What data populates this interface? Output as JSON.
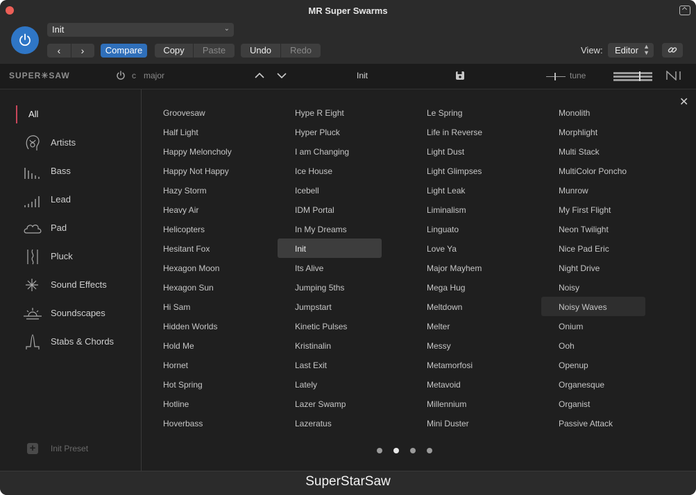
{
  "window": {
    "title": "MR Super Swarms"
  },
  "toolbar": {
    "preset_value": "Init",
    "prev_label": "‹",
    "next_label": "›",
    "compare_label": "Compare",
    "copy_label": "Copy",
    "paste_label": "Paste",
    "undo_label": "Undo",
    "redo_label": "Redo",
    "view_label": "View:",
    "view_value": "Editor"
  },
  "plugin_header": {
    "logo": "SUPER✳SAW",
    "key": "c",
    "scale": "major",
    "preset_name": "Init",
    "tune_label": "tune"
  },
  "sidebar": {
    "categories": [
      {
        "label": "All",
        "icon": "all-indicator"
      },
      {
        "label": "Artists",
        "icon": "artist-head-icon"
      },
      {
        "label": "Bass",
        "icon": "bass-bars-icon"
      },
      {
        "label": "Lead",
        "icon": "lead-bars-icon"
      },
      {
        "label": "Pad",
        "icon": "cloud-icon"
      },
      {
        "label": "Pluck",
        "icon": "pluck-icon"
      },
      {
        "label": "Sound Effects",
        "icon": "sparkle-icon"
      },
      {
        "label": "Soundscapes",
        "icon": "sunrise-icon"
      },
      {
        "label": "Stabs & Chords",
        "icon": "peak-icon"
      }
    ],
    "init_preset_label": "Init Preset"
  },
  "presets": {
    "columns": [
      [
        "Groovesaw",
        "Half Light",
        "Happy Meloncholy",
        "Happy Not Happy",
        "Hazy Storm",
        "Heavy Air",
        "Helicopters",
        "Hesitant Fox",
        "Hexagon Moon",
        "Hexagon Sun",
        "Hi Sam",
        "Hidden Worlds",
        "Hold Me",
        "Hornet",
        "Hot Spring",
        "Hotline",
        "Hoverbass"
      ],
      [
        "Hype R Eight",
        "Hyper Pluck",
        "I am Changing",
        "Ice House",
        "Icebell",
        "IDM Portal",
        "In My Dreams",
        "Init",
        "Its Alive",
        "Jumping 5ths",
        "Jumpstart",
        "Kinetic Pulses",
        "Kristinalin",
        "Last Exit",
        "Lately",
        "Lazer Swamp",
        "Lazeratus"
      ],
      [
        "Le Spring",
        "Life in Reverse",
        "Light Dust",
        "Light Glimpses",
        "Light Leak",
        "Liminalism",
        "Linguato",
        "Love Ya",
        "Major Mayhem",
        "Mega Hug",
        "Meltdown",
        "Melter",
        "Messy",
        "Metamorfosi",
        "Metavoid",
        "Millennium",
        "Mini Duster"
      ],
      [
        "Monolith",
        "Morphlight",
        "Multi Stack",
        "MultiColor Poncho",
        "Munrow",
        "My First Flight",
        "Neon Twilight",
        "Nice Pad Eric",
        "Night Drive",
        "Noisy",
        "Noisy Waves",
        "Onium",
        "Ooh",
        "Openup",
        "Organesque",
        "Organist",
        "Passive Attack"
      ]
    ],
    "selected": "Init",
    "highlighted": "Noisy Waves",
    "pages": 4,
    "current_page": 2
  },
  "footer": {
    "product_name": "SuperStarSaw"
  }
}
